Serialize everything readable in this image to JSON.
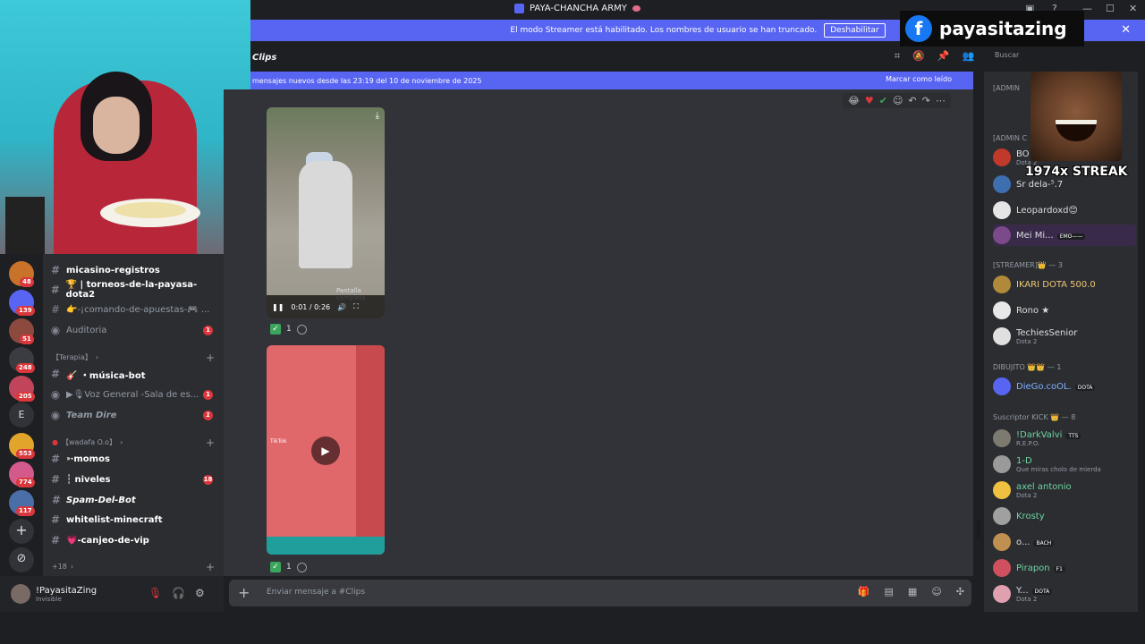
{
  "window": {
    "title": "PAYA-CHANCHA ARMY",
    "controls": [
      "—",
      "☐",
      "✕"
    ]
  },
  "streamer_banner": {
    "text": "El modo Streamer está habilitado. Los nombres de usuario se han truncado.",
    "button": "Deshabilitar"
  },
  "overlay": {
    "facebook_handle": "payasitazing",
    "streak_text": "1974x STREAK"
  },
  "servers": [
    {
      "badge": "48",
      "color": "#c9722a"
    },
    {
      "badge": "139",
      "color": "#5865f2"
    },
    {
      "badge": "51",
      "color": "#8c4a3f"
    },
    {
      "badge": "248",
      "color": "#3a3c42"
    },
    {
      "badge": "205",
      "color": "#c0455a"
    },
    {
      "letter": "E",
      "color": "#313338"
    },
    {
      "badge": "553",
      "color": "#e0a52a"
    },
    {
      "badge": "774",
      "color": "#d45a8c"
    },
    {
      "badge": "117",
      "color": "#4a6ea8"
    }
  ],
  "channels": {
    "items": [
      {
        "name": "micasino-registros",
        "icon": "#",
        "type": "text",
        "bold": true
      },
      {
        "name": "🏆 | torneos-de-la-payasa-dota2",
        "icon": "#",
        "type": "text",
        "bold": true
      },
      {
        "name": "👉-¡comando-de-apuestas-🎮 ...",
        "icon": "#",
        "type": "text"
      },
      {
        "name": "Auditoria",
        "icon": "🔊",
        "type": "voice",
        "unread": "1"
      }
    ],
    "categories": [
      {
        "name": "【Terapia】",
        "items": [
          {
            "name": "🎸 ・música-bot",
            "icon": "#",
            "bold": true
          },
          {
            "name": "▶🎙Voz General -Sala de es...",
            "icon": "🔊",
            "unread": "1"
          },
          {
            "name": "Team Dire",
            "icon": "🔊",
            "unread": "1",
            "italic": true
          }
        ]
      },
      {
        "name": "【wadafa O.o】",
        "items": [
          {
            "name": "➳momos",
            "icon": "#",
            "bold": true
          },
          {
            "name": "┆ niveles",
            "icon": "#",
            "bold": true,
            "unread": "18"
          },
          {
            "name": "Spam-Del-Bot",
            "icon": "#",
            "bold": true,
            "italic": true
          },
          {
            "name": "whitelist-minecraft",
            "icon": "#",
            "bold": true
          },
          {
            "name": "💗-canjeo-de-vip",
            "icon": "#",
            "bold": true
          }
        ]
      }
    ],
    "more": "+18"
  },
  "user": {
    "name": "!PayasitaZing",
    "status": "Invisible"
  },
  "chat": {
    "channel_name": "Clips",
    "new_messages_text": "mensajes nuevos desde las 23:19 del 10 de noviembre de 2025",
    "mark_read": "Marcar como leído",
    "video_time": "0:01 / 0:26",
    "video_tooltip": "Pantalla completa",
    "reaction_count": "1",
    "composer_placeholder": "Enviar mensaje a #",
    "video2_tag": "TikTok"
  },
  "search": {
    "placeholder": "Buscar"
  },
  "members": {
    "groups": [
      {
        "label": "[ADMIN"
      },
      {
        "label": "[ADMIN C"
      },
      {
        "label": "[STREAMER]👑 — 3"
      },
      {
        "label": "DIBUJITO 👑👑 — 1"
      },
      {
        "label": "Suscriptor KICK 👑 — 8"
      }
    ],
    "list": [
      {
        "name": "BO",
        "sub": "Dota 2",
        "color": "#c0392b"
      },
      {
        "name": "Sr dela-⁵.7",
        "sub": "",
        "color": "#3d6fb0"
      },
      {
        "name": "Leopardoxd😊",
        "sub": "",
        "color": "#e6e6e6"
      },
      {
        "name": "Mei Mi...",
        "sub": "",
        "pill": "EMO——",
        "color": "#7a4a8a"
      },
      {
        "name": "IKARI DOTA 500.0",
        "sub": "",
        "color": "#b08a3a"
      },
      {
        "name": "Rono ★",
        "sub": "",
        "color": "#e8e8e8"
      },
      {
        "name": "TechiesSenior",
        "sub": "Dota 2",
        "color": "#e0e0e0"
      },
      {
        "name": "DieGo.coOL.",
        "sub": "",
        "pill": "DOTA",
        "color": "#5865f2"
      },
      {
        "name": "!DarkValvi",
        "sub": "R.E.P.O.",
        "pill": "TTS",
        "color": "#7d7a70"
      },
      {
        "name": "1-D",
        "sub": "Que miras cholo de mierda",
        "color": "#9a9a9a"
      },
      {
        "name": "axel antonio",
        "sub": "Dota 2",
        "color": "#f0c040"
      },
      {
        "name": "Krosty",
        "sub": "",
        "color": "#a0a0a0"
      },
      {
        "name": "o...",
        "sub": "",
        "pill": "BACH",
        "color": "#c09050"
      },
      {
        "name": "Pirapon",
        "sub": "",
        "pill": "F1",
        "color": "#d05060"
      },
      {
        "name": "Y...",
        "sub": "Dota 2",
        "pill": "DOTA",
        "color": "#e0a0b0"
      }
    ]
  },
  "colors": {
    "accent": "#5865f2",
    "bg_dark": "#1e1f22",
    "bg_chat": "#313338",
    "bg_sidebar": "#2b2d31",
    "unread": "#da373c"
  }
}
